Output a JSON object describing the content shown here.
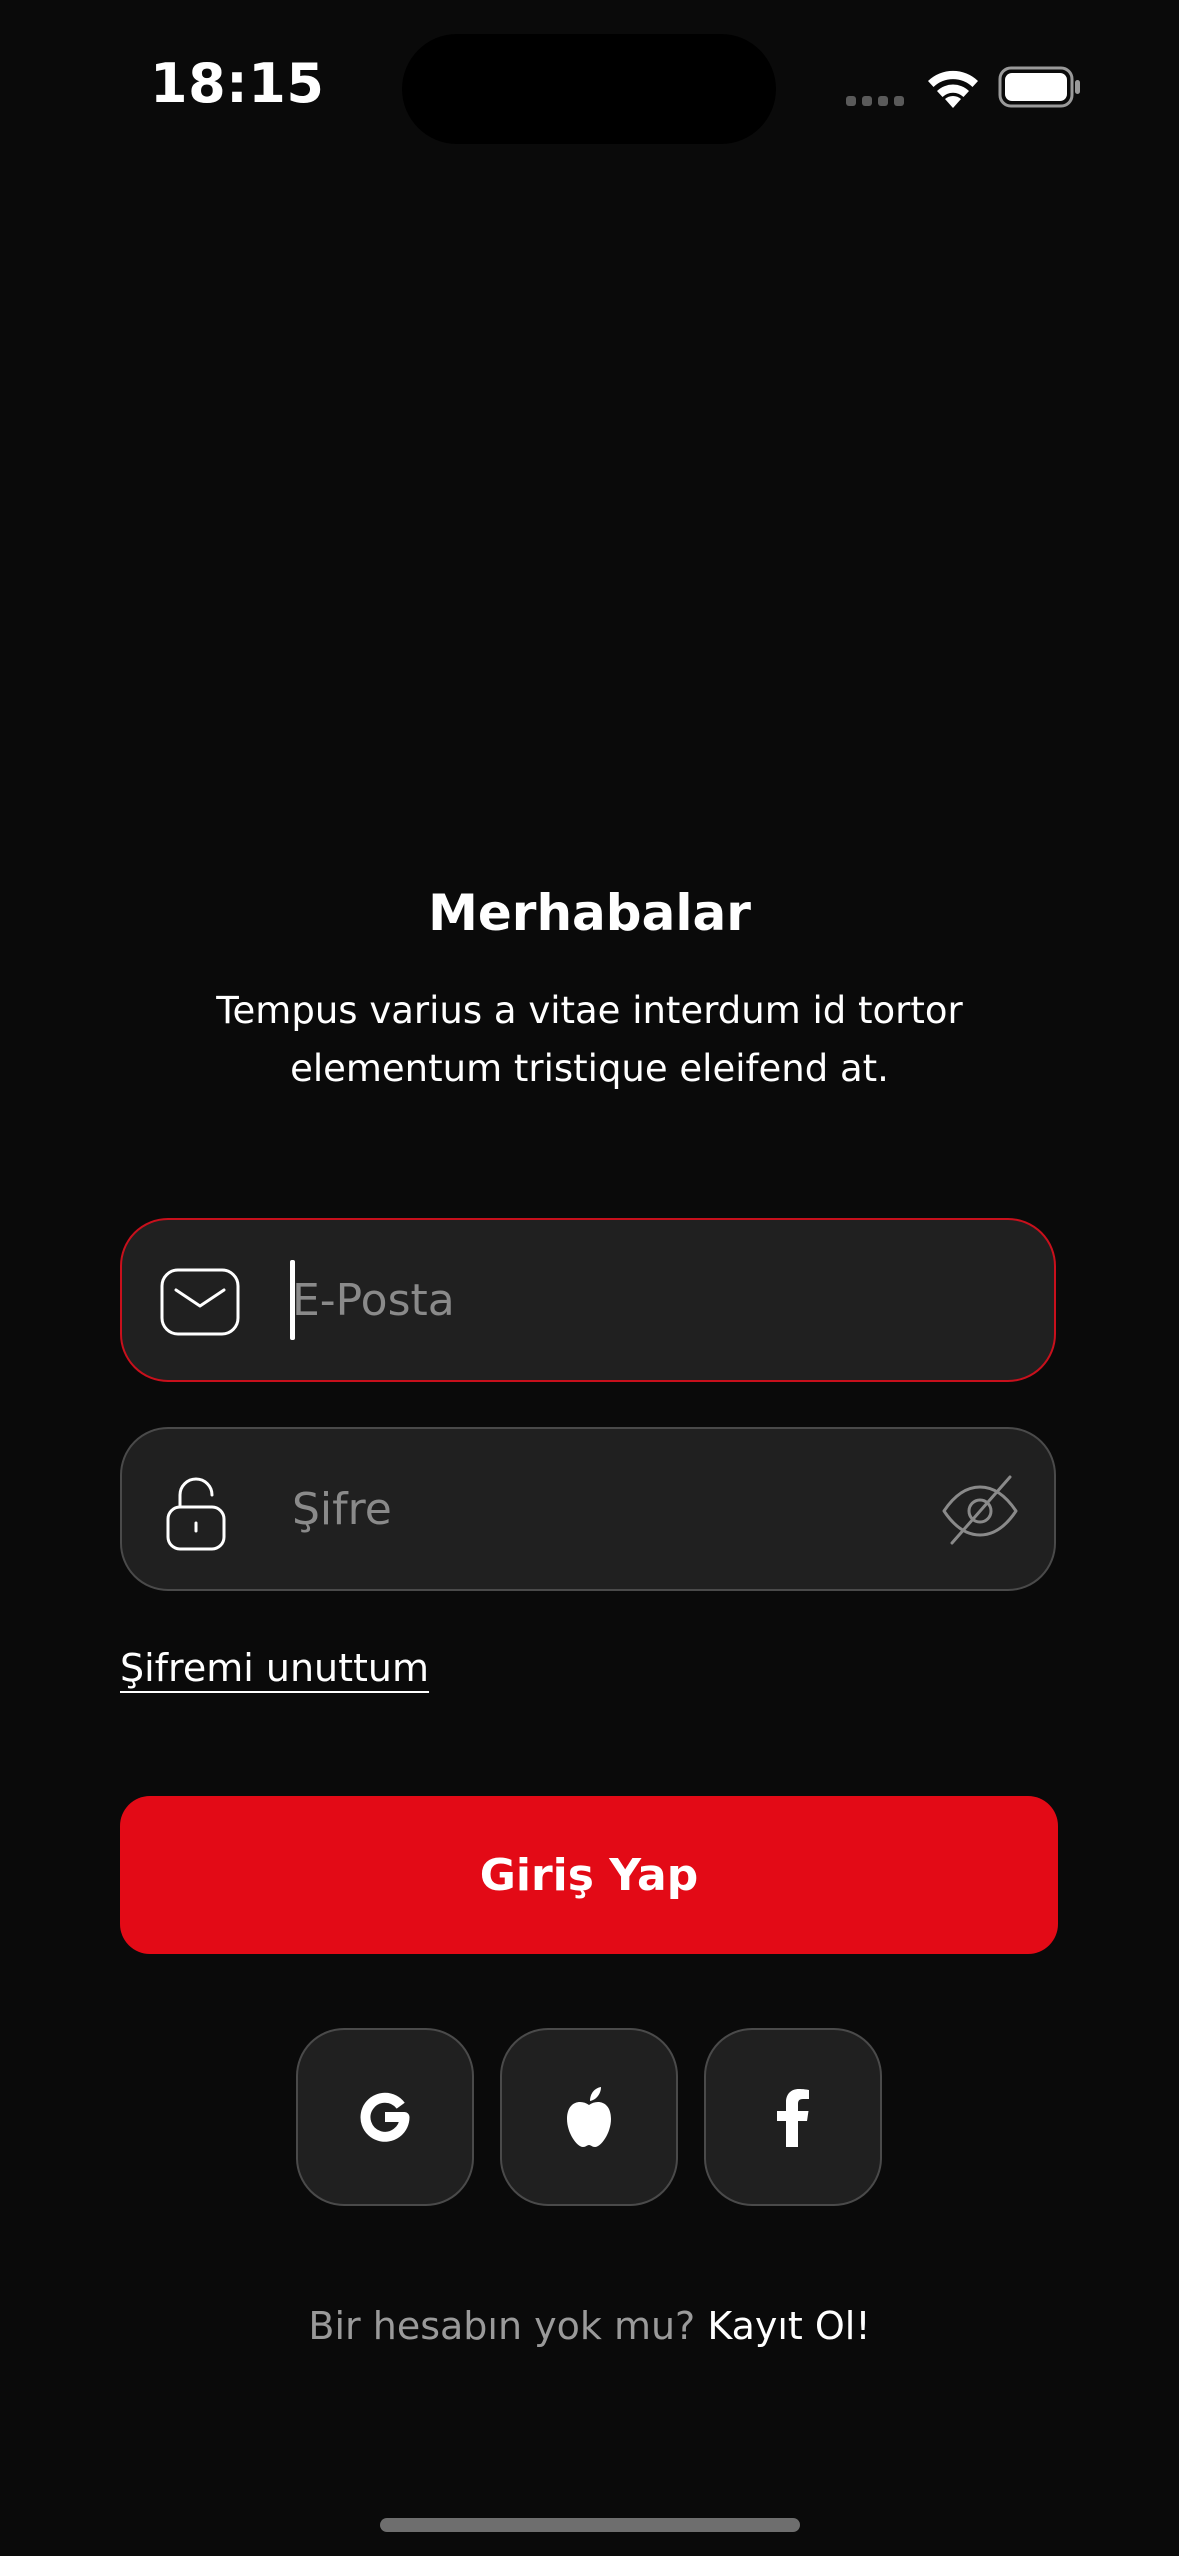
{
  "status_bar": {
    "time": "18:15",
    "icons": [
      "signal-icon",
      "wifi-icon",
      "battery-icon"
    ]
  },
  "welcome": {
    "title": "Merhabalar",
    "subtitle": "Tempus varius a vitae interdum id tortor elementum tristique eleifend at."
  },
  "form": {
    "email": {
      "placeholder": "E-Posta",
      "value": "",
      "icon": "mail-icon",
      "focused": true
    },
    "password": {
      "placeholder": "Şifre",
      "value": "",
      "icon": "unlock-icon",
      "visibility_icon": "eye-off-icon"
    },
    "forgot_password": "Şifremi unuttum",
    "submit_label": "Giriş Yap"
  },
  "social": [
    {
      "provider": "Google",
      "icon": "google-icon"
    },
    {
      "provider": "Apple",
      "icon": "apple-icon"
    },
    {
      "provider": "Facebook",
      "icon": "facebook-icon"
    }
  ],
  "signup": {
    "prompt": "Bir hesabın yok mu?",
    "link": "Kayıt Ol!"
  },
  "colors": {
    "background": "#0a0a0a",
    "accent": "#e30a16",
    "field_background": "#202020",
    "field_border": "#4a4a4a",
    "focused_border": "#c8101c",
    "placeholder": "#8a8a8a",
    "muted_text": "#9a9a9a"
  }
}
